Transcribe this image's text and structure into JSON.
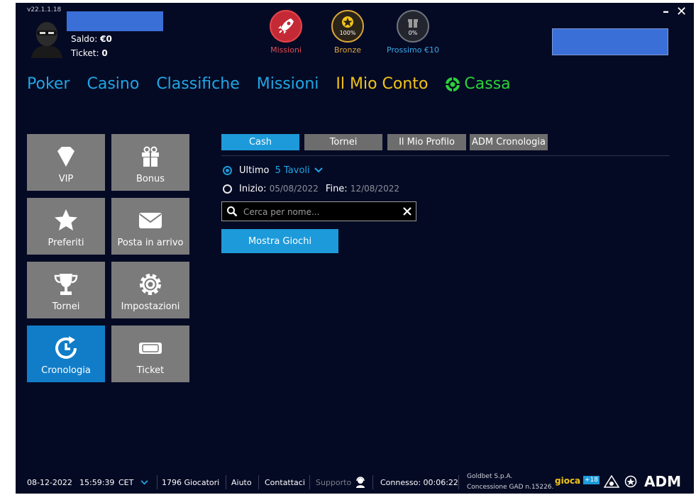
{
  "header": {
    "version": "v22.1.1.18",
    "saldo_label": "Saldo:",
    "saldo_value": "€0",
    "ticket_label": "Ticket:",
    "ticket_value": "0",
    "badges": [
      {
        "label": "Missioni",
        "color": "#e34a52",
        "icon": "rocket-icon"
      },
      {
        "label": "Bronze",
        "pct": "100%",
        "color": "#e0a93a",
        "icon": "star-icon"
      },
      {
        "label": "Prossimo €10",
        "pct": "0%",
        "color": "#3aa9e8",
        "icon": "gift-icon"
      }
    ],
    "minimize": "–",
    "close": "✕"
  },
  "nav": {
    "items": [
      "Poker",
      "Casino",
      "Classifiche",
      "Missioni",
      "Il Mio Conto",
      "Cassa"
    ]
  },
  "tiles": [
    {
      "label": "VIP",
      "icon": "diamond-icon"
    },
    {
      "label": "Bonus",
      "icon": "gift-icon"
    },
    {
      "label": "Preferiti",
      "icon": "star-icon"
    },
    {
      "label": "Posta in arrivo",
      "icon": "envelope-icon"
    },
    {
      "label": "Tornei",
      "icon": "trophy-icon"
    },
    {
      "label": "Impostazioni",
      "icon": "gear-icon"
    },
    {
      "label": "Cronologia",
      "icon": "history-icon",
      "active": true
    },
    {
      "label": "Ticket",
      "icon": "ticket-icon"
    }
  ],
  "tabs": [
    "Cash",
    "Tornei",
    "Il Mio Profilo",
    "ADM Cronologia"
  ],
  "filters": {
    "ultimo_label": "Ultimo",
    "ultimo_value": "5 Tavoli",
    "inizio_label": "Inizio:",
    "inizio_value": "05/08/2022",
    "fine_label": "Fine:",
    "fine_value": "12/08/2022"
  },
  "search": {
    "placeholder": "Cerca per nome..."
  },
  "show_button": "Mostra Giochi",
  "footer": {
    "date": "08-12-2022",
    "time": "15:59:39",
    "tz": "CET",
    "players": "1796 Giocatori",
    "help": "Aiuto",
    "contacts": "Contattaci",
    "support": "Supporto",
    "connected": "Connesso: 00:06:22",
    "company_line1": "Goldbet S.p.A.",
    "company_line2": "Concessione GAD n.15226.",
    "logo_gioca": "gioca",
    "logo_18": "+18",
    "logo_adm": "ADM"
  },
  "colors": {
    "accent": "#1d9ad9",
    "background": "#050a24",
    "nav_yellow": "#f2c418",
    "nav_green": "#2bd23a"
  }
}
